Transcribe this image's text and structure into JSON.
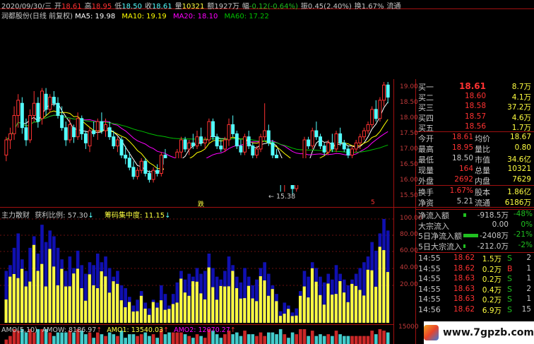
{
  "header": {
    "date": "2020/09/30/三",
    "open_label": "开",
    "open": "18.61",
    "high_label": "高",
    "high": "18.95",
    "low_label": "低",
    "low": "18.50",
    "close_label": "收",
    "close": "18.61",
    "vol_label": "量",
    "vol": "10321",
    "amount_label": "额",
    "amount": "1927万",
    "change_label": "幅",
    "change": "-0.12(-0.64%)",
    "amp_label": "振",
    "amp": "0.45(2.40%)",
    "turnover_label": "换",
    "turnover": "1.67%",
    "float_label": "流通"
  },
  "stock_line": {
    "title": "润都股份(日线 前复权)",
    "ma5": "MA5: 19.98",
    "ma10": "MA10: 19.19",
    "ma20": "MA20: 18.10",
    "ma60": "MA60: 17.22"
  },
  "colors": {
    "up": "#ff3232",
    "down": "#54ffff",
    "ma5": "#ffffff",
    "ma10": "#ffff00",
    "ma20": "#ff00ff",
    "ma60": "#00c000",
    "bar_yellow": "#ffff40",
    "bar_blue": "#1010b0",
    "bar_red": "#d02020",
    "bar_green": "#20c020",
    "frame": "#a01010"
  },
  "price_axis": {
    "ticks": [
      "19.00",
      "18.50",
      "18.00",
      "17.50",
      "17.00",
      "16.50",
      "16.00",
      "15.50"
    ]
  },
  "annotations": {
    "low_marker": "15.38",
    "tag_left": "跌",
    "tag_right": "5"
  },
  "indicator": {
    "title": "主力散财",
    "profit_ratio": "获利比例: 57.30",
    "chip_conc": "筹码集中度: 11.15",
    "ticks": [
      "100.00",
      "80.00",
      "60.00",
      "40.00",
      "20.00"
    ]
  },
  "volume_panel": {
    "title": "AMO(5,10)",
    "amow": "AMOW: 8186.97",
    "amo1": "AMO1: 13540.03",
    "amo2": "AMO2: 12070.27",
    "tick": "15000"
  },
  "order_book": [
    {
      "label": "买一",
      "price": "18.61",
      "vol": "8.7万"
    },
    {
      "label": "买二",
      "price": "18.60",
      "vol": "4.1万"
    },
    {
      "label": "买三",
      "price": "18.58",
      "vol": "37.2万"
    },
    {
      "label": "买四",
      "price": "18.57",
      "vol": "4.6万"
    },
    {
      "label": "买五",
      "price": "18.56",
      "vol": "1.7万"
    }
  ],
  "stats": [
    {
      "l1": "今开",
      "v1": "18.61",
      "l2": "均价",
      "v2": "18.67"
    },
    {
      "l1": "最高",
      "v1": "18.95",
      "l2": "量比",
      "v2": "0.80"
    },
    {
      "l1": "最低",
      "v1": "18.50",
      "l2": "市值",
      "v2": "34.6亿"
    },
    {
      "l1": "现量",
      "v1": "164",
      "l2": "总量",
      "v2": "10321"
    },
    {
      "l1": "外盘",
      "v1": "2692",
      "l2": "内盘",
      "v2": "7629"
    }
  ],
  "stats2": [
    {
      "l1": "换手",
      "v1": "1.67%",
      "l2": "股本",
      "v2": "1.86亿"
    },
    {
      "l1": "净资",
      "v1": "5.21",
      "l2": "流通",
      "v2": "6186万"
    }
  ],
  "flows": [
    {
      "label": "净流入额",
      "val": "-918.5万",
      "pct": "-48%",
      "bar": 0.15
    },
    {
      "label": "大宗流入",
      "val": "0.00",
      "pct": "0%",
      "bar": 0
    },
    {
      "label": "5日净流入额",
      "val": "-2408万",
      "pct": "-21%",
      "bar": 0.75
    },
    {
      "label": "5日大宗流入",
      "val": "-212.0万",
      "pct": "-2%",
      "bar": 0.1
    }
  ],
  "ticks_list": [
    {
      "time": "14:55",
      "price": "18.62",
      "vol": "1.5万",
      "side": "S",
      "n": "2"
    },
    {
      "time": "14:55",
      "price": "18.62",
      "vol": "0.2万",
      "side": "B",
      "n": "1"
    },
    {
      "time": "14:55",
      "price": "18.63",
      "vol": "0.2万",
      "side": "S",
      "n": "1"
    },
    {
      "time": "14:55",
      "price": "18.63",
      "vol": "0.4万",
      "side": "S",
      "n": "2"
    },
    {
      "time": "14:55",
      "price": "18.63",
      "vol": "0.2万",
      "side": "S",
      "n": "1"
    },
    {
      "time": "14:56",
      "price": "18.62",
      "vol": "6.9万",
      "side": "S",
      "n": "15"
    }
  ],
  "watermark": "www.7gpzb.com",
  "chart_data": {
    "type": "candlestick",
    "title": "润都股份(日线 前复权)",
    "ylim": [
      15.3,
      19.1
    ],
    "candles": [
      [
        16.7,
        17.3,
        16.5,
        17.2
      ],
      [
        17.2,
        17.6,
        16.9,
        17.4
      ],
      [
        17.4,
        18.3,
        17.2,
        18.0
      ],
      [
        18.0,
        18.7,
        17.6,
        18.5
      ],
      [
        18.4,
        18.6,
        17.4,
        17.6
      ],
      [
        17.6,
        17.9,
        17.0,
        17.2
      ],
      [
        17.2,
        18.2,
        17.1,
        18.0
      ],
      [
        18.0,
        18.8,
        17.8,
        18.4
      ],
      [
        18.4,
        18.6,
        17.6,
        17.8
      ],
      [
        17.9,
        18.9,
        17.7,
        18.8
      ],
      [
        18.7,
        18.9,
        18.0,
        18.2
      ],
      [
        18.2,
        18.7,
        18.1,
        18.6
      ],
      [
        18.6,
        18.8,
        18.3,
        18.4
      ],
      [
        18.4,
        18.6,
        17.9,
        18.0
      ],
      [
        18.0,
        18.3,
        17.5,
        17.6
      ],
      [
        17.6,
        17.8,
        17.0,
        17.2
      ],
      [
        17.2,
        17.9,
        17.1,
        17.7
      ],
      [
        17.6,
        17.7,
        17.1,
        17.3
      ],
      [
        17.3,
        18.1,
        17.2,
        17.9
      ],
      [
        17.9,
        18.0,
        17.2,
        17.4
      ],
      [
        17.4,
        17.5,
        16.9,
        17.1
      ],
      [
        17.0,
        17.6,
        16.8,
        17.5
      ],
      [
        17.5,
        17.8,
        17.3,
        17.4
      ],
      [
        17.5,
        17.9,
        17.2,
        17.8
      ],
      [
        17.8,
        18.1,
        17.4,
        17.5
      ],
      [
        17.5,
        17.9,
        17.3,
        17.7
      ],
      [
        17.6,
        17.8,
        17.2,
        17.3
      ],
      [
        17.3,
        17.5,
        16.9,
        17.0
      ],
      [
        17.0,
        17.3,
        16.8,
        17.2
      ],
      [
        17.2,
        17.3,
        16.6,
        16.7
      ],
      [
        16.7,
        17.0,
        16.4,
        16.6
      ],
      [
        16.6,
        16.8,
        16.2,
        16.3
      ],
      [
        16.3,
        16.5,
        15.9,
        16.0
      ],
      [
        16.0,
        16.3,
        15.9,
        16.2
      ],
      [
        16.2,
        16.6,
        16.1,
        16.5
      ],
      [
        16.5,
        16.6,
        16.0,
        16.1
      ],
      [
        16.1,
        16.2,
        15.8,
        15.9
      ],
      [
        15.9,
        16.3,
        15.8,
        16.2
      ],
      [
        16.2,
        16.4,
        16.0,
        16.1
      ],
      [
        16.1,
        16.8,
        16.0,
        16.7
      ],
      [
        16.7,
        16.9,
        16.3,
        16.4
      ],
      [
        16.4,
        16.5,
        15.9,
        16.0
      ],
      [
        16.0,
        16.5,
        15.9,
        16.4
      ],
      [
        16.4,
        16.9,
        16.3,
        16.8
      ],
      [
        16.8,
        17.3,
        16.6,
        17.2
      ],
      [
        17.2,
        17.3,
        16.8,
        16.9
      ],
      [
        16.9,
        17.2,
        16.7,
        17.1
      ],
      [
        17.1,
        17.4,
        16.9,
        17.0
      ],
      [
        17.0,
        17.5,
        16.9,
        17.3
      ],
      [
        17.3,
        17.6,
        17.0,
        17.1
      ],
      [
        17.1,
        17.3,
        16.9,
        17.2
      ],
      [
        17.2,
        17.9,
        17.1,
        17.8
      ],
      [
        17.8,
        17.9,
        17.2,
        17.3
      ],
      [
        17.3,
        17.4,
        16.9,
        17.0
      ],
      [
        17.0,
        17.2,
        16.8,
        16.9
      ],
      [
        16.9,
        17.3,
        16.8,
        17.2
      ],
      [
        17.2,
        17.9,
        17.0,
        17.7
      ],
      [
        17.7,
        18.0,
        17.3,
        17.4
      ],
      [
        17.4,
        17.5,
        16.9,
        17.0
      ],
      [
        17.0,
        17.2,
        16.7,
        16.8
      ],
      [
        16.8,
        17.4,
        16.7,
        17.3
      ],
      [
        17.3,
        17.5,
        16.9,
        17.0
      ],
      [
        17.0,
        17.1,
        16.6,
        16.7
      ],
      [
        16.7,
        17.0,
        16.5,
        16.9
      ],
      [
        16.9,
        17.4,
        16.8,
        17.3
      ],
      [
        17.3,
        18.4,
        17.2,
        17.5
      ],
      [
        17.5,
        17.7,
        17.0,
        17.1
      ],
      [
        17.1,
        17.2,
        16.6,
        16.7
      ],
      [
        16.7,
        16.9,
        16.2,
        16.4
      ],
      [
        16.4,
        16.5,
        15.5,
        15.8
      ],
      [
        15.8,
        16.2,
        15.5,
        16.1
      ],
      [
        16.1,
        16.3,
        15.9,
        16.0
      ],
      [
        16.0,
        16.2,
        15.4,
        15.6
      ],
      [
        15.6,
        16.0,
        15.5,
        15.9
      ],
      [
        15.9,
        16.6,
        15.8,
        16.5
      ],
      [
        16.5,
        17.3,
        16.4,
        17.2
      ],
      [
        17.2,
        17.3,
        16.9,
        17.0
      ],
      [
        17.0,
        17.6,
        16.9,
        17.5
      ],
      [
        17.5,
        17.8,
        17.2,
        17.3
      ],
      [
        17.3,
        17.4,
        16.9,
        17.0
      ],
      [
        17.0,
        17.1,
        16.7,
        16.8
      ],
      [
        16.8,
        17.2,
        16.7,
        17.1
      ],
      [
        17.1,
        17.4,
        16.8,
        16.9
      ],
      [
        16.9,
        17.5,
        16.8,
        17.4
      ],
      [
        17.4,
        17.6,
        17.0,
        17.1
      ],
      [
        17.1,
        17.2,
        16.8,
        16.9
      ],
      [
        16.9,
        17.0,
        16.6,
        16.7
      ],
      [
        16.7,
        17.0,
        16.6,
        16.9
      ],
      [
        16.9,
        17.2,
        16.8,
        17.1
      ],
      [
        17.1,
        17.4,
        16.9,
        17.3
      ],
      [
        17.3,
        17.6,
        17.2,
        17.5
      ],
      [
        17.5,
        17.8,
        17.4,
        17.7
      ],
      [
        17.7,
        18.3,
        17.6,
        18.2
      ],
      [
        18.2,
        18.5,
        17.8,
        17.9
      ],
      [
        17.9,
        18.6,
        17.8,
        18.5
      ],
      [
        18.5,
        19.1,
        18.3,
        19.0
      ],
      [
        19.0,
        19.1,
        18.4,
        18.6
      ]
    ]
  }
}
